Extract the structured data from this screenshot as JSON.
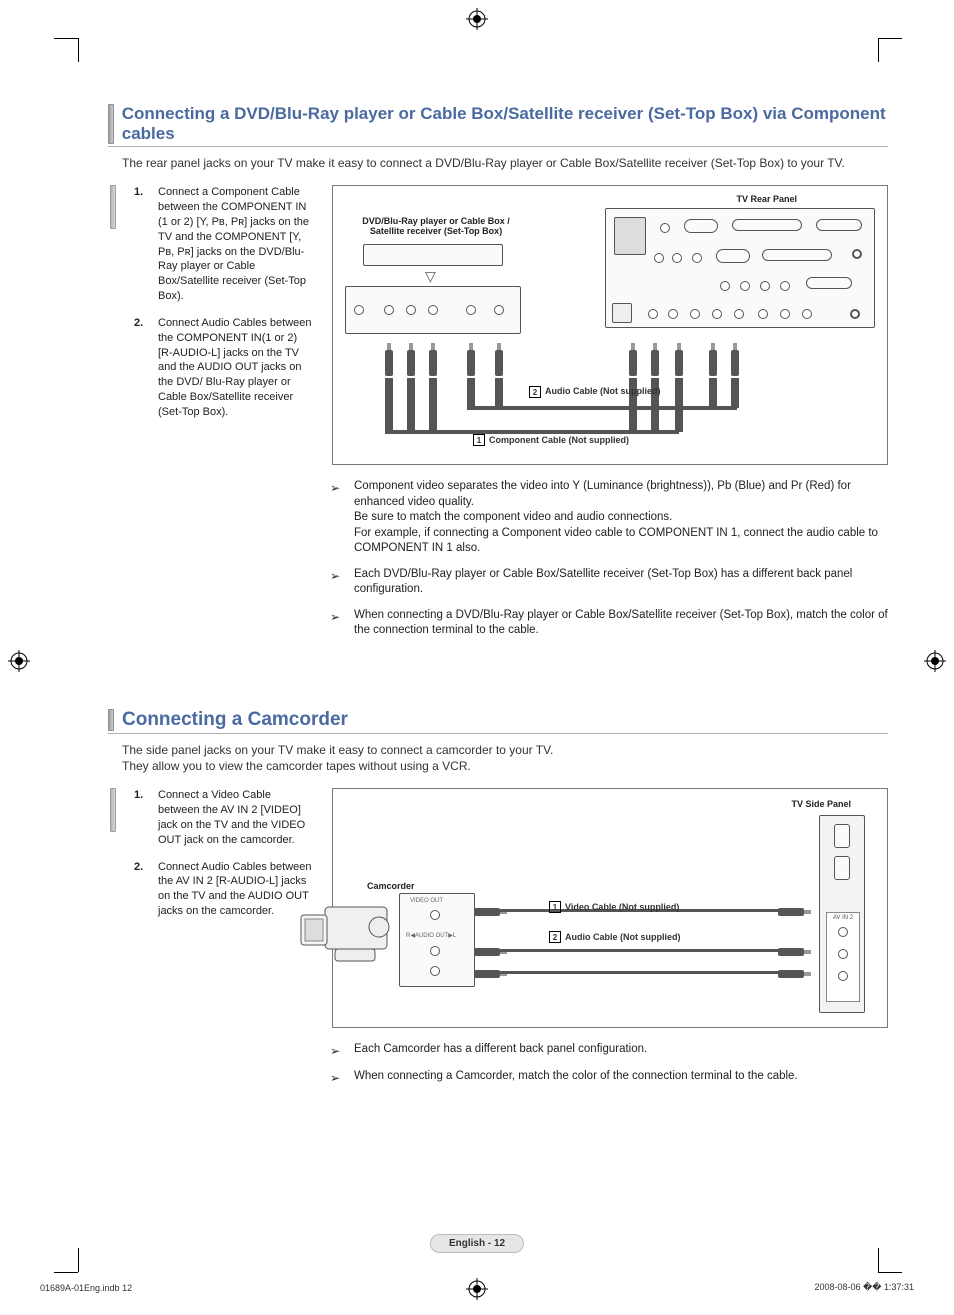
{
  "registration_icon": "registration-target",
  "section1": {
    "title": "Connecting a DVD/Blu-Ray player or Cable Box/Satellite receiver (Set-Top Box) via Component cables",
    "intro": "The rear panel jacks on your TV make it easy to connect a DVD/Blu-Ray player or Cable Box/Satellite receiver (Set-Top Box) to your TV.",
    "steps": [
      "Connect a Component Cable between the COMPONENT IN (1 or 2) [Y, Pʙ, Pʀ] jacks on the TV and the COMPONENT [Y, Pʙ, Pʀ] jacks on the DVD/Blu-Ray player or Cable Box/Satellite receiver (Set-Top Box).",
      "Connect Audio Cables between the COMPONENT IN(1 or 2) [R-AUDIO-L] jacks on the TV and the AUDIO OUT jacks on the DVD/ Blu-Ray player or Cable Box/Satellite receiver (Set-Top Box)."
    ],
    "diagram": {
      "source_label": "DVD/Blu-Ray player or Cable Box / Satellite receiver (Set-Top Box)",
      "panel_label": "TV Rear Panel",
      "callout1_num": "1",
      "callout1_text": "Component Cable (Not supplied)",
      "callout2_num": "2",
      "callout2_text": "Audio Cable (Not supplied)"
    },
    "notes": [
      "Component video separates the video into Y (Luminance (brightness)), Pb (Blue) and Pr (Red) for enhanced video quality.\nBe sure to match the component video and audio connections.\nFor example, if connecting a Component video cable to COMPONENT IN 1, connect the audio cable to COMPONENT IN 1 also.",
      "Each DVD/Blu-Ray player or Cable Box/Satellite receiver (Set-Top Box) has a different back panel configuration.",
      "When connecting a DVD/Blu-Ray player or Cable Box/Satellite receiver (Set-Top Box), match the color of the connection terminal to the cable."
    ]
  },
  "section2": {
    "title": "Connecting a Camcorder",
    "intro": "The side panel jacks on your TV make it easy to connect a camcorder to your TV.\nThey allow you to view the camcorder tapes without using a VCR.",
    "steps": [
      "Connect a Video Cable between the AV IN 2 [VIDEO] jack on the TV and the VIDEO OUT jack on the camcorder.",
      "Connect Audio Cables between the AV IN 2 [R-AUDIO-L] jacks on the TV and the AUDIO OUT jacks on the camcorder."
    ],
    "diagram": {
      "source_label": "Camcorder",
      "panel_label": "TV Side Panel",
      "callout1_num": "1",
      "callout1_text": "Video Cable (Not supplied)",
      "callout2_num": "2",
      "callout2_text": "Audio Cable (Not supplied)"
    },
    "notes": [
      "Each Camcorder has a different back panel configuration.",
      "When connecting a Camcorder, match the color of the connection terminal to the cable."
    ]
  },
  "page_badge": "English - 12",
  "footer": {
    "left": "01689A-01Eng.indb   12",
    "right": "2008-08-06   �� 1:37:31"
  }
}
